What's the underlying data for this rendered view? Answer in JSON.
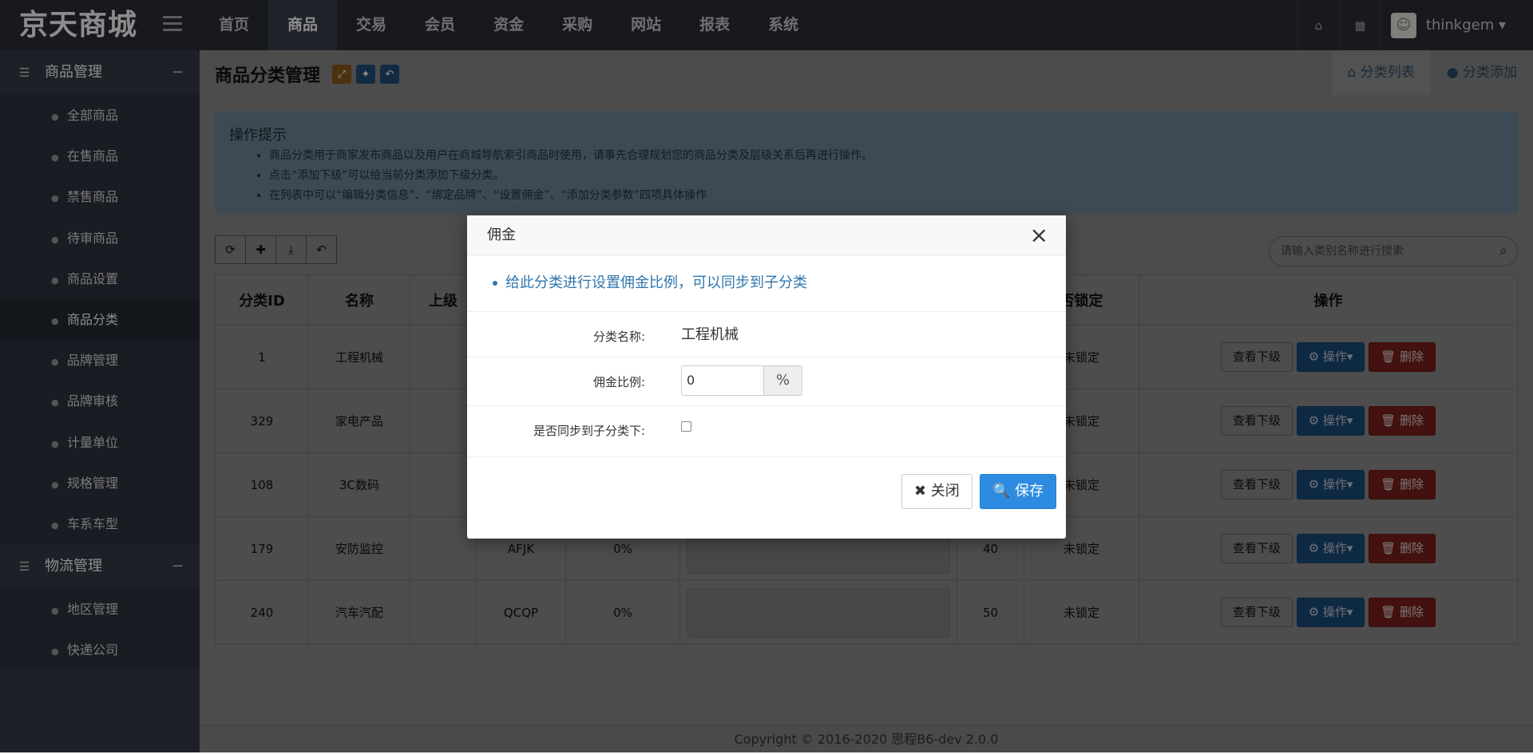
{
  "app": {
    "brand": "京天商城"
  },
  "nav": {
    "items": [
      "首页",
      "商品",
      "交易",
      "会员",
      "资金",
      "采购",
      "网站",
      "报表",
      "系统"
    ],
    "active": 1
  },
  "user": {
    "name": "thinkgem ▾"
  },
  "sidebar": {
    "group1": "商品管理",
    "items1": [
      "全部商品",
      "在售商品",
      "禁售商品",
      "待审商品",
      "商品设置",
      "商品分类",
      "品牌管理",
      "品牌审核",
      "计量单位",
      "规格管理",
      "车系车型"
    ],
    "active": 5,
    "group2": "物流管理",
    "items2": [
      "地区管理",
      "快递公司"
    ],
    "collapse": "−"
  },
  "page": {
    "title": "商品分类管理",
    "tabs": [
      "分类列表",
      "分类添加"
    ],
    "tip_head": "操作提示",
    "tips": [
      "商品分类用于商家发布商品以及用户在商城导航索引商品时使用，请事先合理规划您的商品分类及层级关系后再进行操作。",
      "点击“添加下级”可以给当前分类添加下级分类。",
      "在列表中可以“编辑分类信息”、“绑定品牌”、“设置佣金”、“添加分类参数”四项具体操作"
    ],
    "search_placeholder": "请输入类别名称进行搜索"
  },
  "table": {
    "headers": [
      "分类ID",
      "名称",
      "上级",
      "",
      "",
      "",
      "",
      "否锁定",
      "操作"
    ],
    "rows": [
      {
        "id": "1",
        "name": "工程机械",
        "code": "",
        "rate": "",
        "sort": "",
        "lock": "未锁定"
      },
      {
        "id": "329",
        "name": "家电产品",
        "code": "",
        "rate": "",
        "sort": "",
        "lock": "未锁定"
      },
      {
        "id": "108",
        "name": "3C数码",
        "code": "",
        "rate": "",
        "sort": "",
        "lock": "未锁定"
      },
      {
        "id": "179",
        "name": "安防监控",
        "code": "AFJK",
        "rate": "0%",
        "sort": "40",
        "lock": "未锁定"
      },
      {
        "id": "240",
        "name": "汽车汽配",
        "code": "QCQP",
        "rate": "0%",
        "sort": "50",
        "lock": "未锁定"
      }
    ],
    "btn_view": "查看下级",
    "btn_op": "⚙ 操作▾",
    "btn_del": "🗑 删除"
  },
  "footer": "Copyright © 2016-2020  思程B6-dev  2.0.0",
  "modal": {
    "title": "佣金",
    "note": "给此分类进行设置佣金比例，可以同步到子分类",
    "label_name": "分类名称:",
    "value_name": "工程机械",
    "label_rate": "佣金比例:",
    "value_rate": "0",
    "rate_unit": "%",
    "label_sync": "是否同步到子分类下:",
    "btn_close": "✖ 关闭",
    "btn_save": "🔍 保存"
  }
}
